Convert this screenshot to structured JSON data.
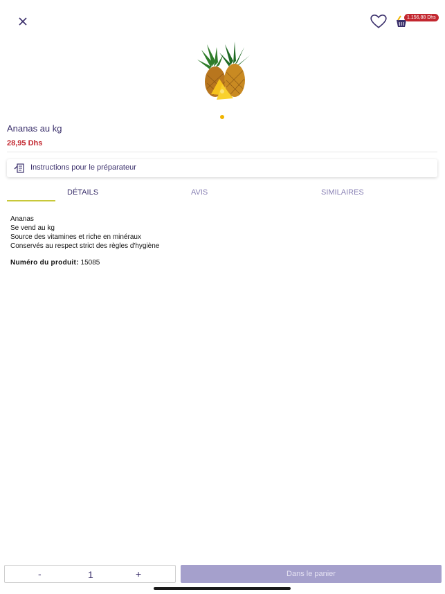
{
  "header": {
    "cart_total": "1.156,88 Dhs"
  },
  "product": {
    "title": "Ananas au kg",
    "price": "28,95 Dhs",
    "image_icon": "pineapple-image",
    "carousel": {
      "current": 1,
      "total": 1
    }
  },
  "instructions": {
    "label": "Instructions pour le préparateur",
    "icon": "note-edit-icon"
  },
  "tabs": [
    {
      "label": "DÉTAILS",
      "active": true
    },
    {
      "label": "AVIS",
      "active": false
    },
    {
      "label": "SIMILAIRES",
      "active": false
    }
  ],
  "details": {
    "lines": [
      "Ananas",
      "Se vend au kg",
      "Source des vitamines et riche en minéraux",
      "Conservés au respect strict des règles d'hygiène"
    ],
    "product_number_label": "Numéro du produit:",
    "product_number_value": "15085"
  },
  "footer": {
    "minus": "-",
    "quantity": "1",
    "plus": "+",
    "add_to_cart": "Dans le panier"
  },
  "colors": {
    "brand": "#3a2f6b",
    "price": "#c3272f",
    "accent_underline": "#c8c83a",
    "dot": "#f0b400",
    "button_disabled": "#a5a0cc"
  }
}
